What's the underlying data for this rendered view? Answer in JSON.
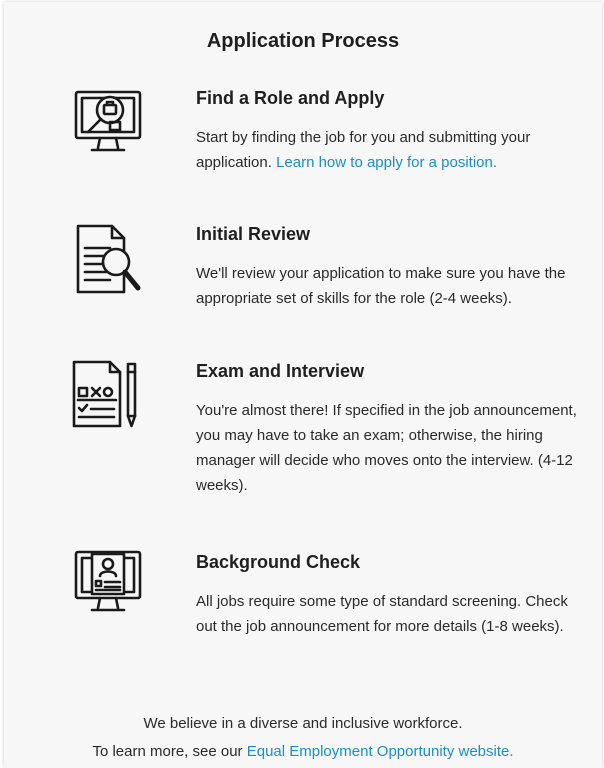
{
  "page": {
    "title": "Application Process"
  },
  "steps": [
    {
      "icon": "computer-search-icon",
      "heading": "Find a Role and Apply",
      "text": "Start by finding the job for you and submitting your application.",
      "link": "Learn how to apply for a position."
    },
    {
      "icon": "document-magnifier-icon",
      "heading": "Initial Review",
      "text": "We'll review your application to make sure you have the appropriate set of skills for the role (2-4 weeks)."
    },
    {
      "icon": "exam-pencil-icon",
      "heading": "Exam and Interview",
      "text": "You're almost there! If specified in the job announcement, you may have to take an exam; otherwise, the hiring manager will decide who moves onto the interview. (4-12 weeks)."
    },
    {
      "icon": "computer-profile-icon",
      "heading": "Background Check",
      "text": "All jobs require some type of standard screening. Check out the job announcement for more details (1-8 weeks)."
    }
  ],
  "footer": {
    "line1": "We believe in a diverse and inclusive workforce.",
    "line2_prefix": "To learn more, see our",
    "link": "Equal Employment Opportunity website."
  },
  "colors": {
    "link": "#1a8fc7",
    "text": "#2a2a2a",
    "card_background": "#f7f7f7"
  }
}
